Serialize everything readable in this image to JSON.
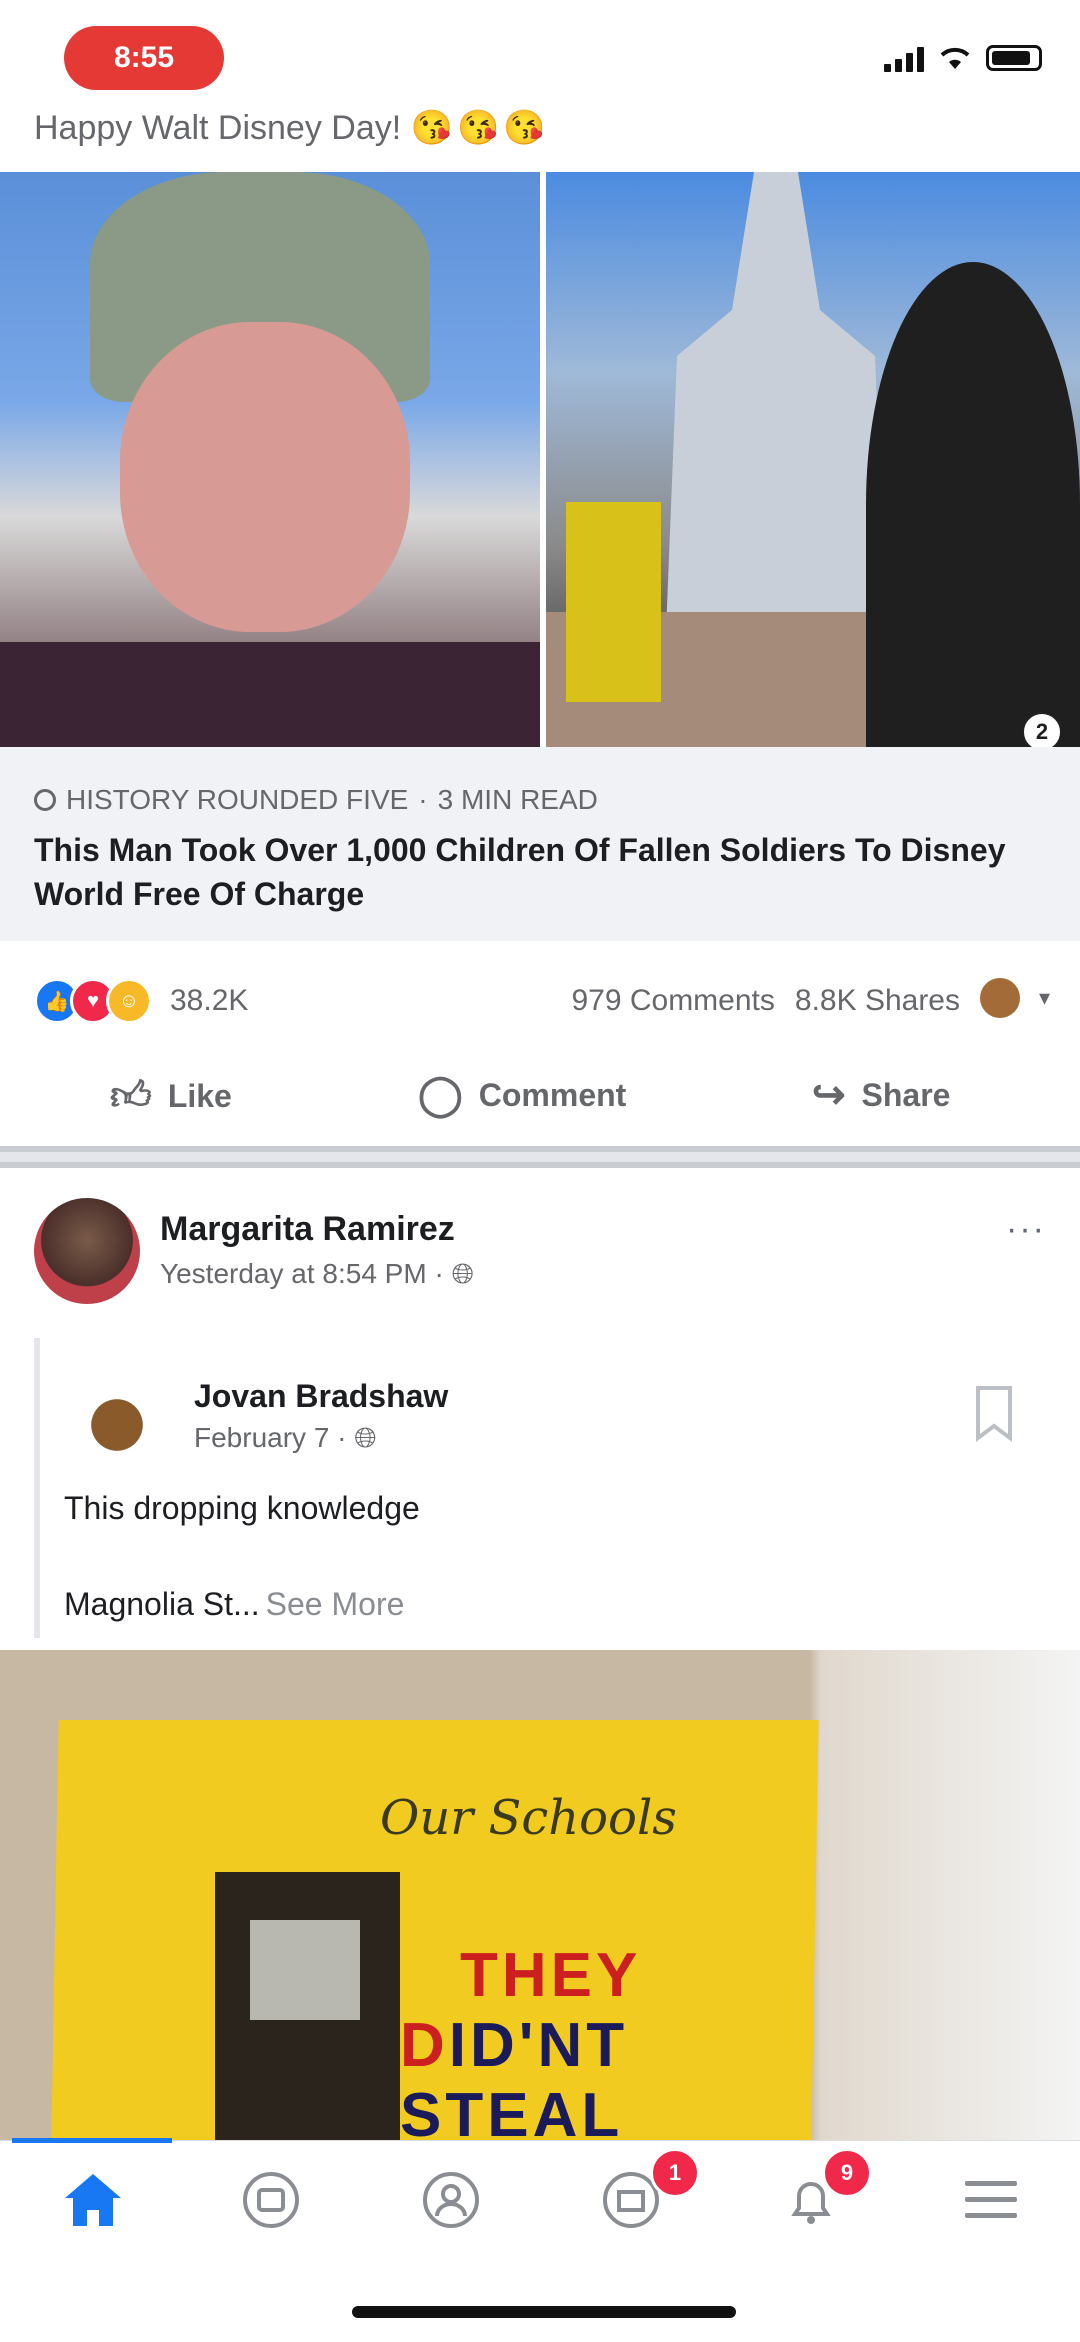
{
  "status_bar": {
    "time": "8:55",
    "icons": [
      "signal-icon",
      "wifi-icon",
      "battery-icon"
    ]
  },
  "top_caption": {
    "text": "Happy Walt Disney Day!",
    "emoji": "😘😘😘"
  },
  "link_post": {
    "photo_count_label": "2",
    "source": "HISTORY ROUNDED FIVE",
    "read_time": "3 MIN READ",
    "title": "This Man Took Over 1,000 Children Of Fallen Soldiers To Disney World Free Of Charge",
    "reaction_count": "38.2K",
    "comments": "979 Comments",
    "shares": "8.8K Shares"
  },
  "actions": {
    "like": "Like",
    "comment": "Comment",
    "share": "Share"
  },
  "post": {
    "author": "Margarita Ramirez",
    "time": "Yesterday at 8:54 PM ·",
    "shared": {
      "author": "Jovan Bradshaw",
      "time": "February 7 ·",
      "text": "This dropping knowledge",
      "preview": "Magnolia St...",
      "see_more": "See More"
    },
    "image_sign": {
      "script_text": "Our Schools",
      "line1": "THEY",
      "line2_red": "D",
      "line2_rest": "ID'NT",
      "line3": "STEAL"
    }
  },
  "tabbar": {
    "tabs": [
      {
        "name": "home",
        "icon": "home-icon"
      },
      {
        "name": "watch",
        "icon": "video-icon"
      },
      {
        "name": "profile",
        "icon": "profile-icon"
      },
      {
        "name": "marketplace",
        "icon": "store-icon"
      },
      {
        "name": "notifications",
        "icon": "bell-icon"
      },
      {
        "name": "menu",
        "icon": "menu-icon"
      }
    ],
    "badges": {
      "marketplace": "1",
      "notifications": "9"
    }
  },
  "colors": {
    "accent": "#1877f2",
    "badge": "#f02849",
    "status_pill": "#e53935"
  }
}
